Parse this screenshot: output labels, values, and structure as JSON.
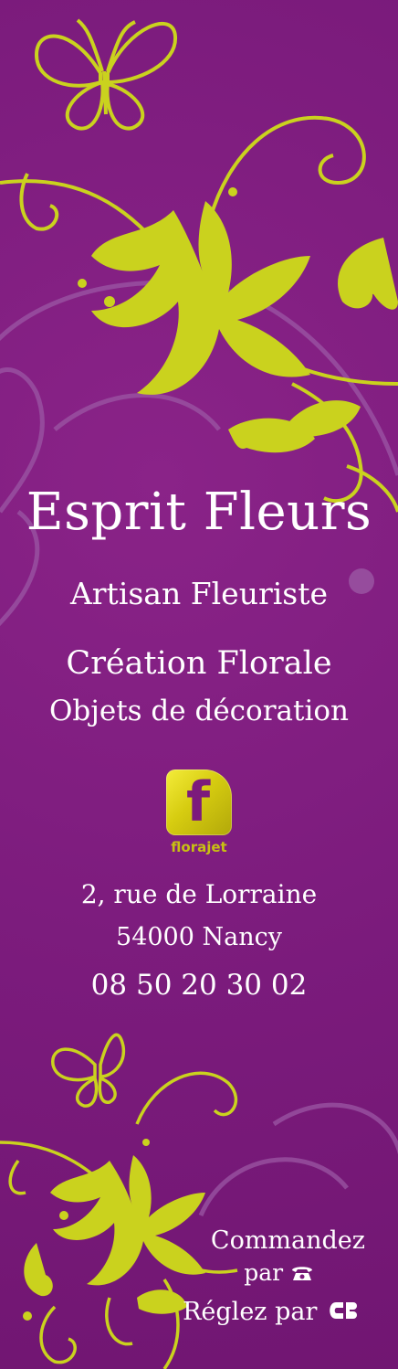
{
  "shop": {
    "name": "Esprit Fleurs",
    "tagline": "Artisan Fleuriste",
    "services": [
      "Création Florale",
      "Objets de décoration"
    ]
  },
  "logo": {
    "mark": "f",
    "wordmark": "florajet",
    "color": "#d6cc10"
  },
  "address": {
    "street": "2, rue de Lorraine",
    "city": "54000 Nancy",
    "phone": "08 50 20 30 02"
  },
  "order": {
    "line1": "Commandez",
    "line2": "par",
    "line2_icon": "telephone-icon",
    "line3": "Réglez par",
    "line3_icon": "carte-bancaire-icon"
  },
  "colors": {
    "background": "#7c1a7c",
    "floral": "#cad21e",
    "swirl": "#9b57a4"
  }
}
